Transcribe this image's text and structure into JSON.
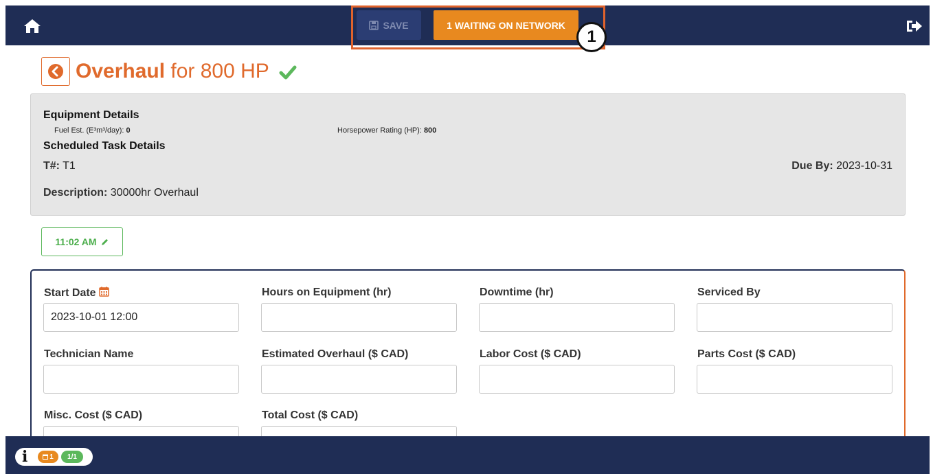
{
  "topbar": {
    "save_label": "SAVE",
    "waiting_label": "1 WAITING ON NETWORK",
    "step_number": "1"
  },
  "title": {
    "bold": "Overhaul",
    "rest": " for 800 HP"
  },
  "details": {
    "equipment_heading": "Equipment Details",
    "fuel_label": "Fuel Est. (E³m³/day): ",
    "fuel_value": "0",
    "hp_label": "Horsepower Rating (HP): ",
    "hp_value": "800",
    "task_heading": "Scheduled Task Details",
    "task_num_label": "T#:",
    "task_num_value": " T1",
    "due_label": "Due By:",
    "due_value": " 2023-10-31",
    "desc_label": "Description:",
    "desc_value": " 30000hr Overhaul"
  },
  "time_button": {
    "label": "11:02 AM"
  },
  "form": {
    "start_date": {
      "label": "Start Date",
      "value": "2023-10-01 12:00"
    },
    "hours": {
      "label": "Hours on Equipment (hr)",
      "value": ""
    },
    "downtime": {
      "label": "Downtime (hr)",
      "value": ""
    },
    "serviced_by": {
      "label": "Serviced By",
      "value": ""
    },
    "technician": {
      "label": "Technician Name",
      "value": ""
    },
    "est_overhaul": {
      "label": "Estimated Overhaul ($ CAD)",
      "value": ""
    },
    "labor_cost": {
      "label": "Labor Cost ($ CAD)",
      "value": ""
    },
    "parts_cost": {
      "label": "Parts Cost ($ CAD)",
      "value": ""
    },
    "misc_cost": {
      "label": "Misc. Cost ($ CAD)",
      "value": ""
    },
    "total_cost": {
      "label": "Total Cost ($ CAD)",
      "value": ""
    }
  },
  "status": {
    "pending_count": "1",
    "sync_count": "1/1"
  },
  "colors": {
    "navy": "#1f2d55",
    "orange": "#e06a2c",
    "warning": "#e8891f",
    "success": "#5cb85c"
  },
  "icons": [
    "home-icon",
    "logout-icon",
    "floppy-icon",
    "chevron-left-icon",
    "check-icon",
    "calendar-icon",
    "pencil-icon",
    "info-icon",
    "calendar-small-icon"
  ]
}
